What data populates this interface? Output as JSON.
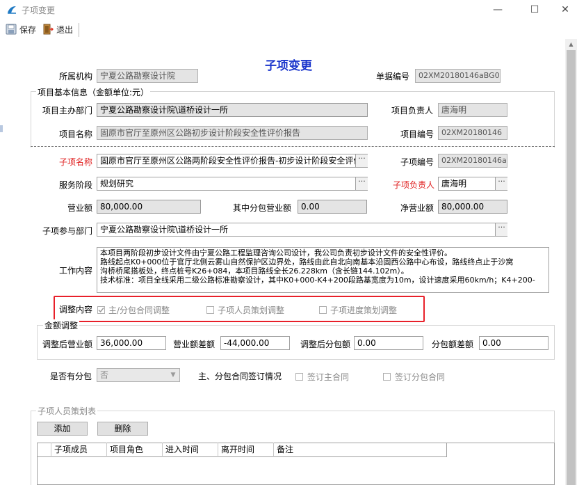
{
  "window": {
    "title": "子项变更",
    "minimize": "—",
    "maximize": "☐",
    "close": "✕"
  },
  "toolbar": {
    "save_label": "保存",
    "exit_label": "退出"
  },
  "form_title": "子项变更",
  "header": {
    "org_label": "所属机构",
    "org_value": "宁夏公路勘察设计院",
    "doc_no_label": "单据编号",
    "doc_no_value": "02XM20180146aBG01"
  },
  "basic_info": {
    "group_title": "项目基本信息（金额单位:元）",
    "dept_label": "项目主办部门",
    "dept_value": "宁夏公路勘察设计院\\道桥设计一所",
    "leader_label": "项目负责人",
    "leader_value": "唐海明",
    "name_label": "项目名称",
    "name_value": "固原市官厅至原州区公路初步设计阶段安全性评价报告",
    "code_label": "项目编号",
    "code_value": "02XM20180146"
  },
  "sub_item": {
    "name_label": "子项名称",
    "name_value": "固原市官厅至原州区公路两阶段安全性评价报告-初步设计阶段安全评价",
    "code_label": "子项编号",
    "code_value": "02XM20180146a",
    "stage_label": "服务阶段",
    "stage_value": "规划研究",
    "leader_label": "子项负责人",
    "leader_value": "唐海明",
    "revenue_label": "营业额",
    "revenue_value": "80,000.00",
    "sub_revenue_label": "其中分包营业额",
    "sub_revenue_value": "0.00",
    "net_revenue_label": "净营业额",
    "net_revenue_value": "80,000.00",
    "dept_label": "子项参与部门",
    "dept_value": "宁夏公路勘察设计院\\道桥设计一所",
    "content_label": "工作内容",
    "content_lines": [
      "本项目两阶段初步设计文件由宁夏公路工程监理咨询公司设计，我公司负责初步设计文件的安全性评价。",
      "路线起点K0+000位于官厅北侧云雾山自然保护区边界处，路线由此自北向南基本沿固西公路中心布设，路线终点止于沙窝",
      "沟桥桥尾搭板处，终点桩号K26+084，本项目路线全长26.228km（含长链144.102m）。",
      "技术标准：项目全线采用二级公路标准勘察设计，其中K0+000-K4+200段路基宽度为10m，设计速度采用60km/h；K4+200-"
    ]
  },
  "adjust": {
    "label": "调整内容",
    "options": [
      {
        "label": "主/分包合同调整",
        "checked": true
      },
      {
        "label": "子项人员策划调整",
        "checked": false
      },
      {
        "label": "子项进度策划调整",
        "checked": false
      }
    ]
  },
  "amount": {
    "group_title": "金额调整",
    "adj_revenue_label": "调整后营业额",
    "adj_revenue_value": "36,000.00",
    "diff_label": "营业额差额",
    "diff_value": "-44,000.00",
    "adj_sub_label": "调整后分包额",
    "adj_sub_value": "0.00",
    "sub_diff_label": "分包额差额",
    "sub_diff_value": "0.00"
  },
  "subcontract": {
    "has_sub_label": "是否有分包",
    "has_sub_value": "否",
    "contract_label": "主、分包合同签订情况",
    "sign_main_label": "签订主合同",
    "sign_sub_label": "签订分包合同"
  },
  "staff": {
    "group_title": "子项人员策划表",
    "add_label": "添加",
    "delete_label": "删除",
    "columns": [
      "子项成员",
      "项目角色",
      "进入时间",
      "离开时间",
      "备注"
    ]
  },
  "colors": {
    "title_blue": "#1a35cc",
    "required_red": "#e02020",
    "highlight_red": "#e8202a"
  }
}
